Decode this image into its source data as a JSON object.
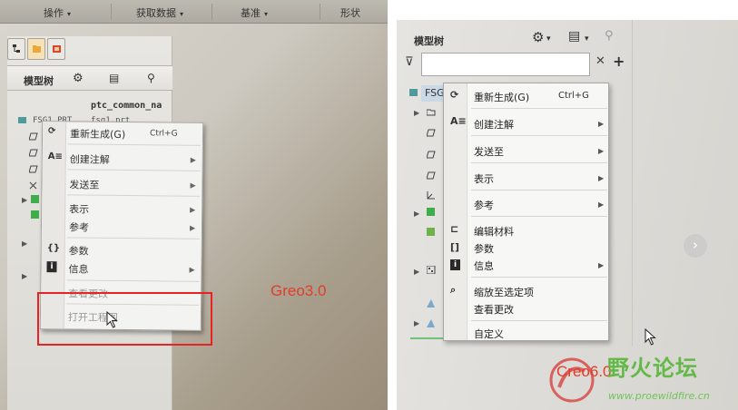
{
  "left_panel": {
    "menubar": [
      {
        "label": "操作"
      },
      {
        "label": "获取数据"
      },
      {
        "label": "基准"
      },
      {
        "label": "形状"
      }
    ],
    "model_tree_title": "模型树",
    "column_header": "ptc_common_na",
    "tree_rows": [
      "FSG1.PRT",
      "fsg1.prt"
    ],
    "context_menu": {
      "items": [
        {
          "label": "重新生成(G)",
          "shortcut": "Ctrl+G"
        },
        {
          "label": "创建注解"
        },
        {
          "label": "发送至"
        },
        {
          "label": "表示"
        },
        {
          "label": "参考"
        },
        {
          "label": "参数"
        },
        {
          "label": "信息"
        },
        {
          "label": "查看更改"
        },
        {
          "label": "打开工程图"
        }
      ]
    },
    "version_label": "Greo3.0",
    "highlight_color": "#e62424"
  },
  "right_panel": {
    "model_tree_title": "模型树",
    "search": {
      "value": "",
      "placeholder": ""
    },
    "root_label": "FSG",
    "context_menu": {
      "items": [
        {
          "label": "重新生成(G)",
          "shortcut": "Ctrl+G"
        },
        {
          "label": "创建注解"
        },
        {
          "label": "发送至"
        },
        {
          "label": "表示"
        },
        {
          "label": "参考"
        },
        {
          "label": "编辑材料"
        },
        {
          "label": "参数"
        },
        {
          "label": "信息"
        },
        {
          "label": "缩放至选定项"
        },
        {
          "label": "查看更改"
        },
        {
          "label": "自定义"
        }
      ]
    },
    "version_label": "Creo6.0",
    "nav_arrow": "›"
  },
  "watermark": {
    "title": "野火论坛",
    "url": "www.proewildfire.cn",
    "color": "#62b947"
  },
  "icons": {
    "filter": "filter-icon",
    "clear": "close-icon",
    "add": "plus-icon",
    "settings": "settings-icon",
    "show": "show-icon"
  }
}
